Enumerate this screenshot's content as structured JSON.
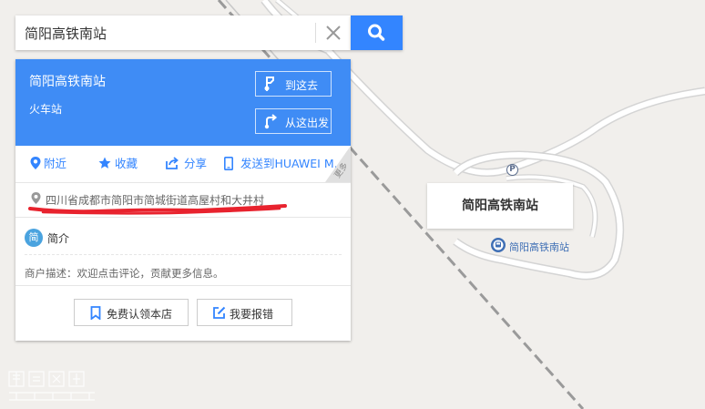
{
  "search": {
    "value": "简阳高铁南站"
  },
  "card": {
    "place_name": "简阳高铁南站",
    "place_type": "火车站",
    "route_to_label": "到这去",
    "route_from_label": "从这出发",
    "actions": {
      "nearby": "附近",
      "favorite": "收藏",
      "share": "分享",
      "send_to_phone": "发送到HUAWEI M...",
      "more": "更多"
    },
    "address": "四川省成都市简阳市简城街道高屋村和大井村",
    "intro_badge": "简",
    "intro_label": "简介",
    "merchant_description": "商户描述：欢迎点击评论，贡献更多信息。",
    "claim_store_label": "免费认领本店",
    "report_error_label": "我要报错"
  },
  "map": {
    "popup_title": "简阳高铁南站",
    "station_label": "简阳高铁南站",
    "parking_symbol": "P"
  },
  "colors": {
    "accent": "#3385ff",
    "header": "#3f8cf5",
    "annotation": "#e8232e"
  }
}
